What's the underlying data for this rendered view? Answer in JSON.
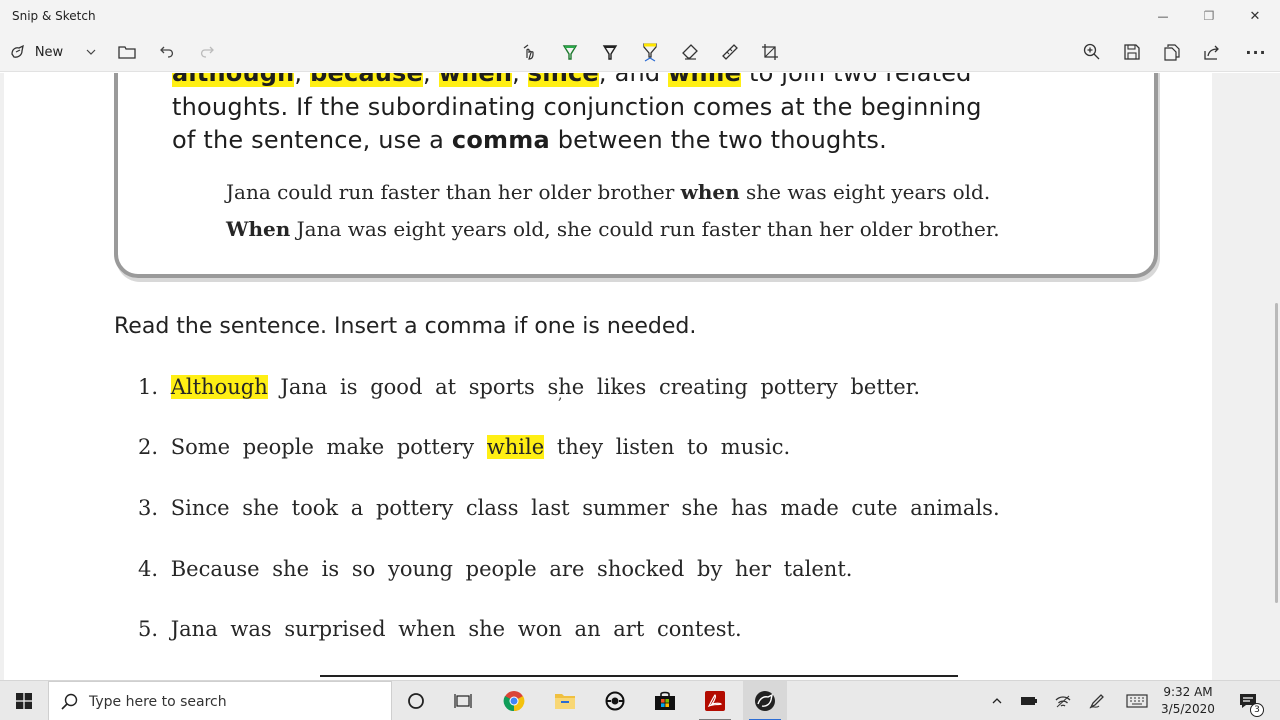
{
  "window": {
    "title": "Snip & Sketch",
    "minimize": "—",
    "restore": "❐",
    "close": "✕"
  },
  "toolbar": {
    "new_label": "New",
    "more": "···"
  },
  "document": {
    "rule": {
      "line1_parts": [
        "although",
        ", ",
        "because",
        ", ",
        "when",
        ", ",
        "since",
        ", and ",
        "while",
        " to join two related"
      ],
      "line2": "thoughts. If the subordinating conjunction comes at the beginning",
      "line3_pre": "of the sentence, use a ",
      "line3_bold": "comma",
      "line3_post": " between the two thoughts."
    },
    "examples": [
      {
        "pre": "Jana could run faster than her older brother ",
        "bold": "when",
        "post": " she was eight years old."
      },
      {
        "pre": "",
        "bold": "When",
        "post": " Jana was eight years old, she could run faster than her older brother."
      }
    ],
    "instruction": "Read the sentence. Insert a comma if one is needed.",
    "items": [
      {
        "num": "1.",
        "highlight": "Although",
        "rest": " Jana is good at sports she likes creating pottery better."
      },
      {
        "num": "2.",
        "pre": "Some people make pottery ",
        "highlight": "while",
        "rest": " they listen to music."
      },
      {
        "num": "3.",
        "text": "Since she took a pottery class last summer she has made cute animals."
      },
      {
        "num": "4.",
        "text": "Because she is so young people are shocked by her talent."
      },
      {
        "num": "5.",
        "text": "Jana was surprised when she won an art contest."
      }
    ],
    "handwritten_comma": ","
  },
  "taskbar": {
    "search_placeholder": "Type here to search",
    "time": "9:32 AM",
    "date": "3/5/2020",
    "notification_count": "3"
  },
  "colors": {
    "highlight": "#ffef14",
    "chrome_accent": "#2b6cd4"
  }
}
